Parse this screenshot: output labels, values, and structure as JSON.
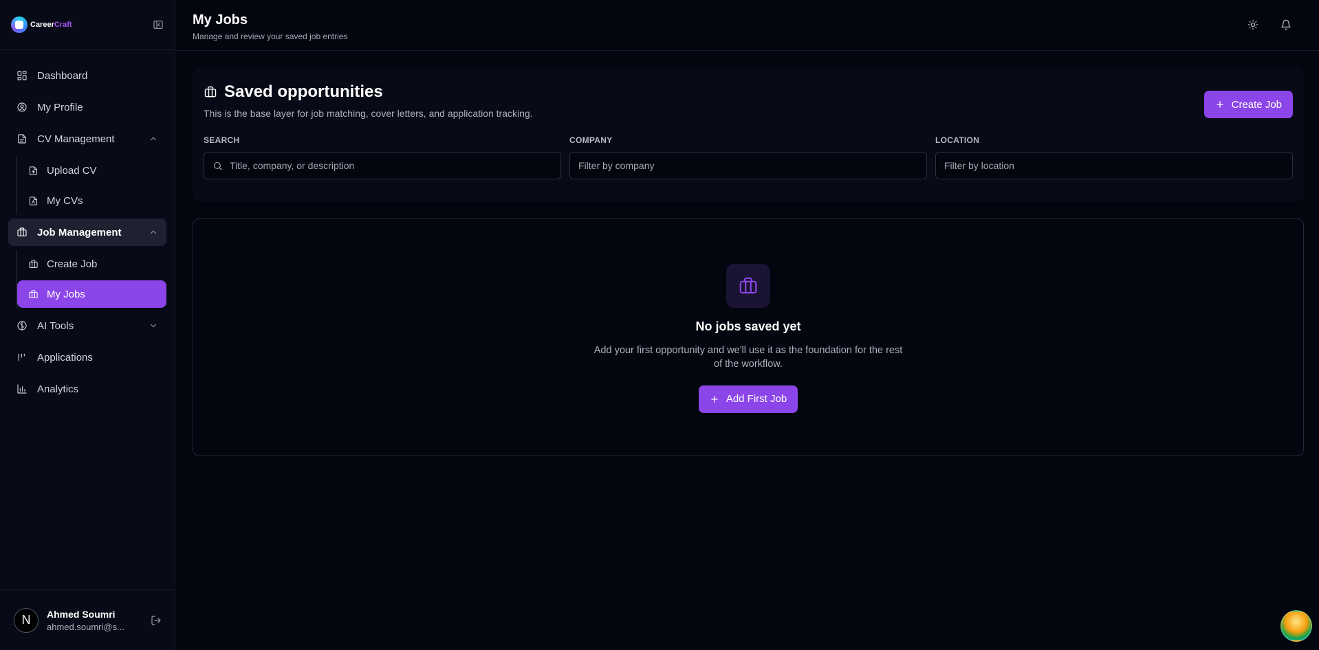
{
  "brand": {
    "name_part1": "Career",
    "name_part2": "Craft"
  },
  "sidebar": {
    "items": [
      {
        "label": "Dashboard",
        "icon": "dashboard-icon"
      },
      {
        "label": "My Profile",
        "icon": "profile-icon"
      },
      {
        "label": "CV Management",
        "icon": "document-icon",
        "expanded": true,
        "children": [
          {
            "label": "Upload CV"
          },
          {
            "label": "My CVs"
          }
        ]
      },
      {
        "label": "Job Management",
        "icon": "briefcase-icon",
        "expanded": true,
        "children": [
          {
            "label": "Create Job"
          },
          {
            "label": "My Jobs",
            "active": true
          }
        ]
      },
      {
        "label": "AI Tools",
        "icon": "brain-icon",
        "expanded": false
      },
      {
        "label": "Applications",
        "icon": "applications-icon"
      },
      {
        "label": "Analytics",
        "icon": "chart-icon"
      }
    ]
  },
  "user": {
    "name": "Ahmed Soumri",
    "email": "ahmed.soumri@s...",
    "avatar_letter": "N"
  },
  "header": {
    "title": "My Jobs",
    "subtitle": "Manage and review your saved job entries"
  },
  "panel": {
    "title": "Saved opportunities",
    "subtitle": "This is the base layer for job matching, cover letters, and application tracking.",
    "create_label": "Create Job",
    "filters": [
      {
        "label": "SEARCH",
        "placeholder": "Title, company, or description"
      },
      {
        "label": "COMPANY",
        "placeholder": "Filter by company"
      },
      {
        "label": "LOCATION",
        "placeholder": "Filter by location"
      }
    ]
  },
  "empty_state": {
    "title": "No jobs saved yet",
    "text": "Add your first opportunity and we'll use it as the foundation for the rest of the workflow.",
    "button_label": "Add First Job"
  },
  "colors": {
    "accent": "#8b45e8",
    "background": "#03050f",
    "sidebar": "#080b17"
  }
}
